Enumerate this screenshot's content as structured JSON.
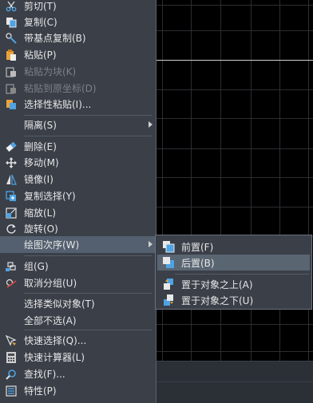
{
  "context_menu": {
    "items": [
      {
        "label": "剪切(T)",
        "icon": "scissors-icon"
      },
      {
        "label": "复制(C)",
        "icon": "copy-icon"
      },
      {
        "label": "带基点复制(B)",
        "icon": "copy-with-basepoint-icon"
      },
      {
        "label": "粘贴(P)",
        "icon": "paste-icon"
      },
      {
        "label": "粘贴为块(K)",
        "icon": "paste-as-block-icon",
        "disabled": true
      },
      {
        "label": "粘贴到原坐标(D)",
        "icon": "paste-to-original-icon",
        "disabled": true
      },
      {
        "label": "选择性粘贴(I)...",
        "icon": "paste-special-icon"
      },
      {
        "label": "隔离(S)",
        "submenu": true
      },
      {
        "label": "删除(E)",
        "icon": "eraser-icon"
      },
      {
        "label": "移动(M)",
        "icon": "move-icon"
      },
      {
        "label": "镜像(I)",
        "icon": "mirror-icon"
      },
      {
        "label": "复制选择(Y)",
        "icon": "copy-selection-icon"
      },
      {
        "label": "缩放(L)",
        "icon": "scale-icon"
      },
      {
        "label": "旋转(O)",
        "icon": "rotate-icon"
      },
      {
        "label": "绘图次序(W)",
        "submenu": true,
        "highlighted": true
      },
      {
        "label": "组(G)",
        "icon": "group-icon"
      },
      {
        "label": "取消分组(U)",
        "icon": "ungroup-icon"
      },
      {
        "label": "选择类似对象(T)"
      },
      {
        "label": "全部不选(A)"
      },
      {
        "label": "快速选择(Q)...",
        "icon": "quick-select-icon"
      },
      {
        "label": "快速计算器(L)",
        "icon": "calculator-icon"
      },
      {
        "label": "查找(F)...",
        "icon": "find-icon"
      },
      {
        "label": "特性(P)",
        "icon": "properties-icon"
      }
    ]
  },
  "draw_order_submenu": {
    "items": [
      {
        "label": "前置(F)",
        "icon": "bring-to-front-icon"
      },
      {
        "label": "后置(B)",
        "icon": "send-to-back-icon",
        "highlighted": true
      },
      {
        "label": "置于对象之上(A)",
        "icon": "bring-above-objects-icon"
      },
      {
        "label": "置于对象之下(U)",
        "icon": "send-under-objects-icon"
      }
    ]
  },
  "colors": {
    "menu_bg": "#3a3f48",
    "highlight": "#54606f",
    "canvas_bg": "#000000",
    "icon_blue": "#4fa3e3",
    "icon_orange": "#e8a33d"
  }
}
